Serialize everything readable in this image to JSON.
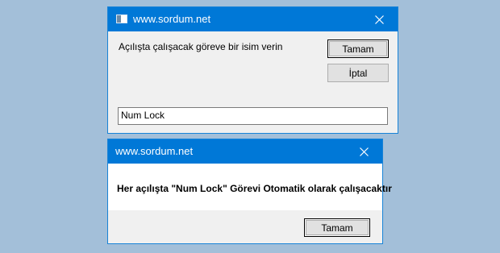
{
  "input_dialog": {
    "title": "www.sordum.net",
    "prompt": "Açılışta çalışacak göreve bir isim verin",
    "ok_label": "Tamam",
    "cancel_label": "İptal",
    "input_value": "Num Lock"
  },
  "message_dialog": {
    "title": "www.sordum.net",
    "message": "Her açılışta \"Num Lock\" Görevi Otomatik olarak çalışacaktır",
    "ok_label": "Tamam"
  },
  "icons": {
    "close": "close-icon",
    "app": "app-icon"
  },
  "colors": {
    "desktop": "#a3bfd9",
    "titlebar": "#0078d7",
    "dialog_face": "#f0f0f0"
  }
}
